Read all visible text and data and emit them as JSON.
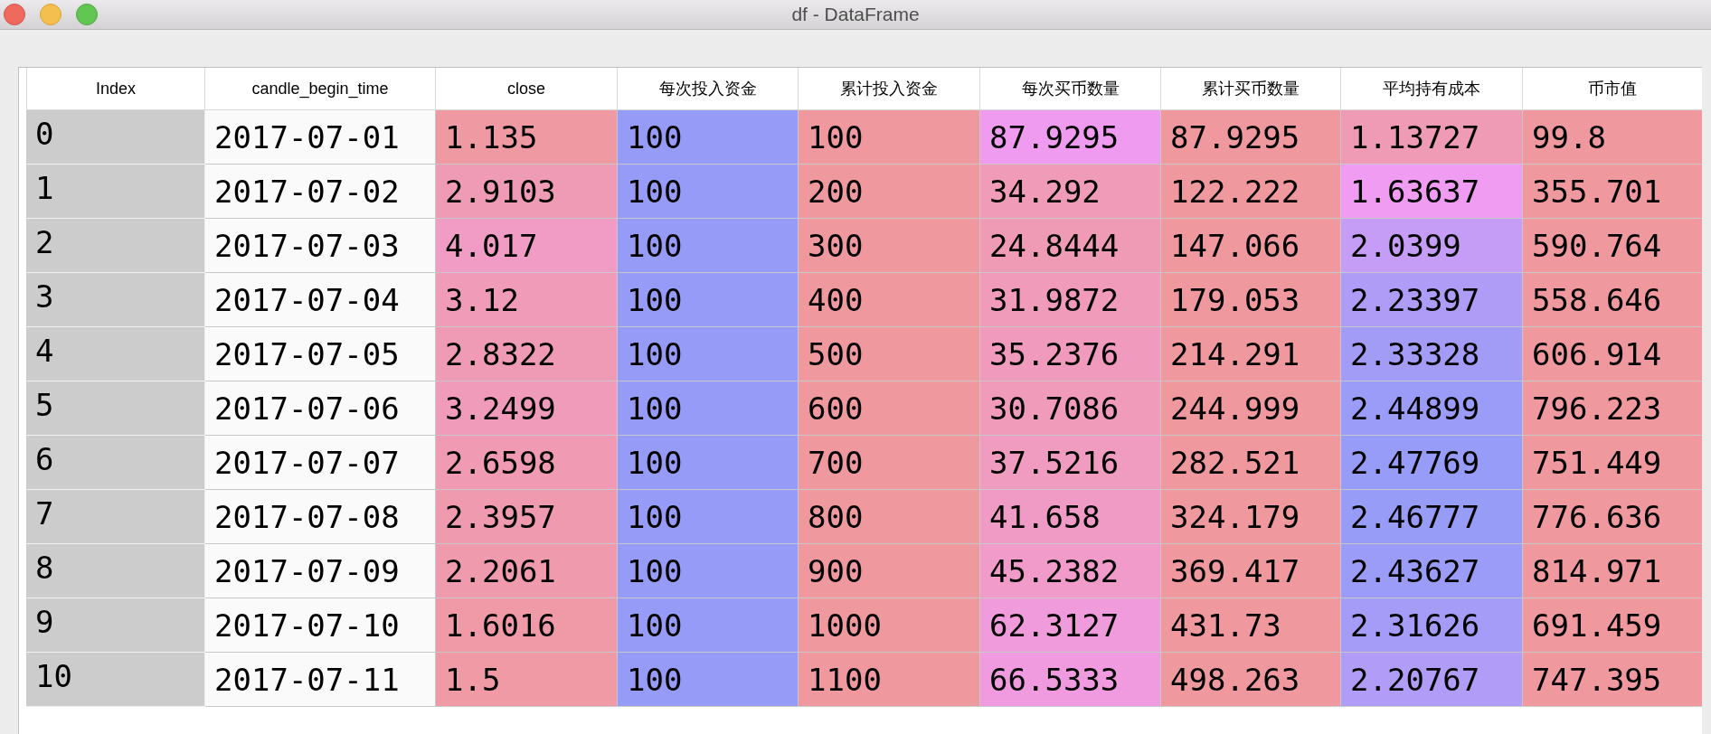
{
  "window": {
    "title": "df - DataFrame"
  },
  "table": {
    "columns": [
      "Index",
      "candle_begin_time",
      "close",
      "每次投入资金",
      "累计投入资金",
      "每次买币数量",
      "累计买币数量",
      "平均持有成本",
      "币市值"
    ],
    "rows": [
      {
        "cells": [
          {
            "text": "0"
          },
          {
            "text": "2017-07-01"
          },
          {
            "text": "1.135",
            "color": "#ef9aa2"
          },
          {
            "text": "100",
            "color": "#959bf7"
          },
          {
            "text": "100",
            "color": "#ef999e"
          },
          {
            "text": "87.9295",
            "color": "#ef9cf0"
          },
          {
            "text": "87.9295",
            "color": "#ef999e"
          },
          {
            "text": "1.13727",
            "color": "#f09bb5"
          },
          {
            "text": "99.8",
            "color": "#ef999e"
          }
        ]
      },
      {
        "cells": [
          {
            "text": "1"
          },
          {
            "text": "2017-07-02"
          },
          {
            "text": "2.9103",
            "color": "#f09bb6"
          },
          {
            "text": "100",
            "color": "#959bf7"
          },
          {
            "text": "200",
            "color": "#ef999e"
          },
          {
            "text": "34.292",
            "color": "#f09bb8"
          },
          {
            "text": "122.222",
            "color": "#ef999e"
          },
          {
            "text": "1.63637",
            "color": "#ef9cf2"
          },
          {
            "text": "355.701",
            "color": "#ef999e"
          }
        ]
      },
      {
        "cells": [
          {
            "text": "2"
          },
          {
            "text": "2017-07-03"
          },
          {
            "text": "4.017",
            "color": "#f09cc4"
          },
          {
            "text": "100",
            "color": "#959bf7"
          },
          {
            "text": "300",
            "color": "#ef999e"
          },
          {
            "text": "24.8444",
            "color": "#f09bb5"
          },
          {
            "text": "147.066",
            "color": "#ef999e"
          },
          {
            "text": "2.0399",
            "color": "#c59cf6"
          },
          {
            "text": "590.764",
            "color": "#ef999e"
          }
        ]
      },
      {
        "cells": [
          {
            "text": "3"
          },
          {
            "text": "2017-07-04"
          },
          {
            "text": "3.12",
            "color": "#f09bb8"
          },
          {
            "text": "100",
            "color": "#959bf7"
          },
          {
            "text": "400",
            "color": "#ef999e"
          },
          {
            "text": "31.9872",
            "color": "#f09bba"
          },
          {
            "text": "179.053",
            "color": "#ef999e"
          },
          {
            "text": "2.23397",
            "color": "#ae9cf6"
          },
          {
            "text": "558.646",
            "color": "#ef999e"
          }
        ]
      },
      {
        "cells": [
          {
            "text": "4"
          },
          {
            "text": "2017-07-05"
          },
          {
            "text": "2.8322",
            "color": "#f09bb5"
          },
          {
            "text": "100",
            "color": "#959bf7"
          },
          {
            "text": "500",
            "color": "#ef999e"
          },
          {
            "text": "35.2376",
            "color": "#f09bbd"
          },
          {
            "text": "214.291",
            "color": "#ef999e"
          },
          {
            "text": "2.33328",
            "color": "#a39cf7"
          },
          {
            "text": "606.914",
            "color": "#ef999e"
          }
        ]
      },
      {
        "cells": [
          {
            "text": "5"
          },
          {
            "text": "2017-07-06"
          },
          {
            "text": "3.2499",
            "color": "#f09bb9"
          },
          {
            "text": "100",
            "color": "#959bf7"
          },
          {
            "text": "600",
            "color": "#ef999e"
          },
          {
            "text": "30.7086",
            "color": "#f09bba"
          },
          {
            "text": "244.999",
            "color": "#ef999e"
          },
          {
            "text": "2.44899",
            "color": "#9a9cf7"
          },
          {
            "text": "796.223",
            "color": "#ef999e"
          }
        ]
      },
      {
        "cells": [
          {
            "text": "6"
          },
          {
            "text": "2017-07-07"
          },
          {
            "text": "2.6598",
            "color": "#f09ab3"
          },
          {
            "text": "100",
            "color": "#959bf7"
          },
          {
            "text": "700",
            "color": "#ef999e"
          },
          {
            "text": "37.5216",
            "color": "#f09bc0"
          },
          {
            "text": "282.521",
            "color": "#ef999e"
          },
          {
            "text": "2.47769",
            "color": "#969cf7"
          },
          {
            "text": "751.449",
            "color": "#ef999e"
          }
        ]
      },
      {
        "cells": [
          {
            "text": "7"
          },
          {
            "text": "2017-07-08"
          },
          {
            "text": "2.3957",
            "color": "#f09ab0"
          },
          {
            "text": "100",
            "color": "#959bf7"
          },
          {
            "text": "800",
            "color": "#ef999e"
          },
          {
            "text": "41.658",
            "color": "#f09bc5"
          },
          {
            "text": "324.179",
            "color": "#ef999e"
          },
          {
            "text": "2.46777",
            "color": "#979cf7"
          },
          {
            "text": "776.636",
            "color": "#ef999e"
          }
        ]
      },
      {
        "cells": [
          {
            "text": "8"
          },
          {
            "text": "2017-07-09"
          },
          {
            "text": "2.2061",
            "color": "#f09aae"
          },
          {
            "text": "100",
            "color": "#959bf7"
          },
          {
            "text": "900",
            "color": "#ef999e"
          },
          {
            "text": "45.2382",
            "color": "#f09bca"
          },
          {
            "text": "369.417",
            "color": "#ef999e"
          },
          {
            "text": "2.43627",
            "color": "#9b9cf7"
          },
          {
            "text": "814.971",
            "color": "#ef999e"
          }
        ]
      },
      {
        "cells": [
          {
            "text": "9"
          },
          {
            "text": "2017-07-10"
          },
          {
            "text": "1.6016",
            "color": "#f09aa8"
          },
          {
            "text": "100",
            "color": "#959bf7"
          },
          {
            "text": "1000",
            "color": "#ef999e"
          },
          {
            "text": "62.3127",
            "color": "#f09bdc"
          },
          {
            "text": "431.73",
            "color": "#ef999e"
          },
          {
            "text": "2.31626",
            "color": "#a59cf7"
          },
          {
            "text": "691.459",
            "color": "#ef999e"
          }
        ]
      },
      {
        "cells": [
          {
            "text": "10"
          },
          {
            "text": "2017-07-11"
          },
          {
            "text": "1.5",
            "color": "#f09aa6"
          },
          {
            "text": "100",
            "color": "#959bf7"
          },
          {
            "text": "1100",
            "color": "#ef999e"
          },
          {
            "text": "66.5333",
            "color": "#f09be0"
          },
          {
            "text": "498.263",
            "color": "#ef999e"
          },
          {
            "text": "2.20767",
            "color": "#b19cf7"
          },
          {
            "text": "747.395",
            "color": "#ef999e"
          }
        ]
      }
    ]
  }
}
